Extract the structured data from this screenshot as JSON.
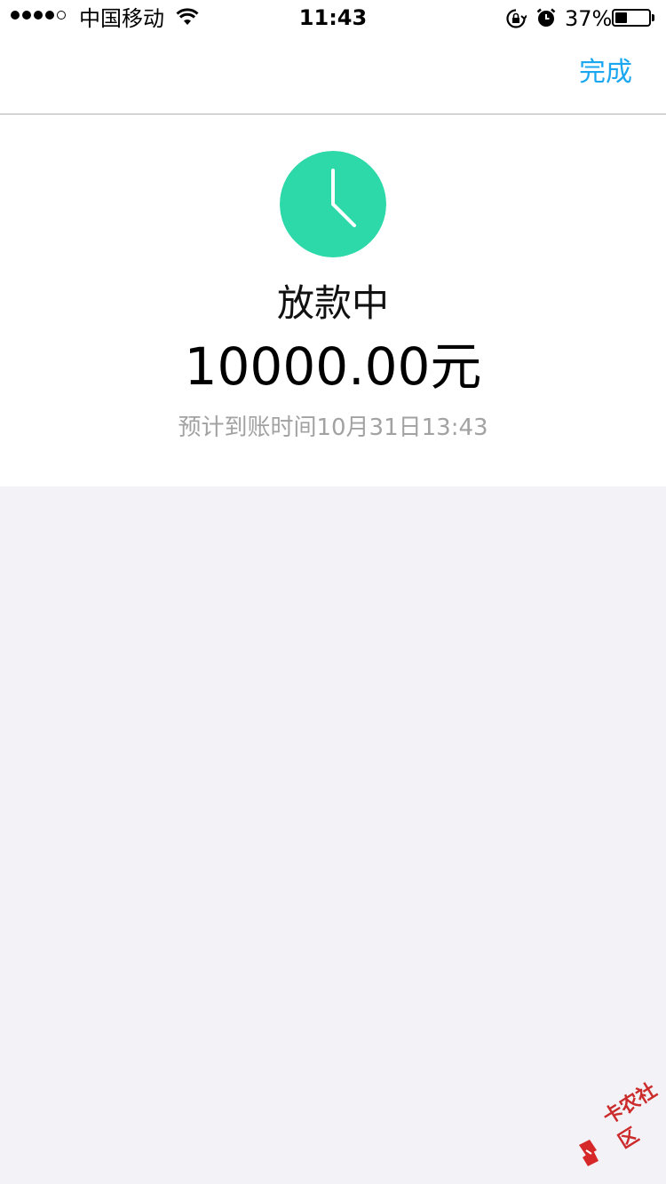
{
  "status_bar": {
    "carrier": "中国移动",
    "time": "11:43",
    "battery_percent_label": "37%",
    "battery_level": 0.37,
    "signal_bars_filled": 4,
    "signal_bars_total": 5,
    "icons": [
      "wifi-icon",
      "rotation-lock-icon",
      "alarm-icon",
      "battery-icon"
    ]
  },
  "nav": {
    "done_label": "完成"
  },
  "result": {
    "icon": "clock-icon",
    "status_title": "放款中",
    "amount": "10000.00元",
    "arrival_time": "预计到账时间10月31日13:43"
  },
  "watermark": {
    "text": "卡农社区"
  },
  "colors": {
    "accent": "#1aa7f0",
    "status_icon": "#2dd8a9",
    "secondary_text": "#a2a2a2",
    "background": "#f3f3f7"
  }
}
